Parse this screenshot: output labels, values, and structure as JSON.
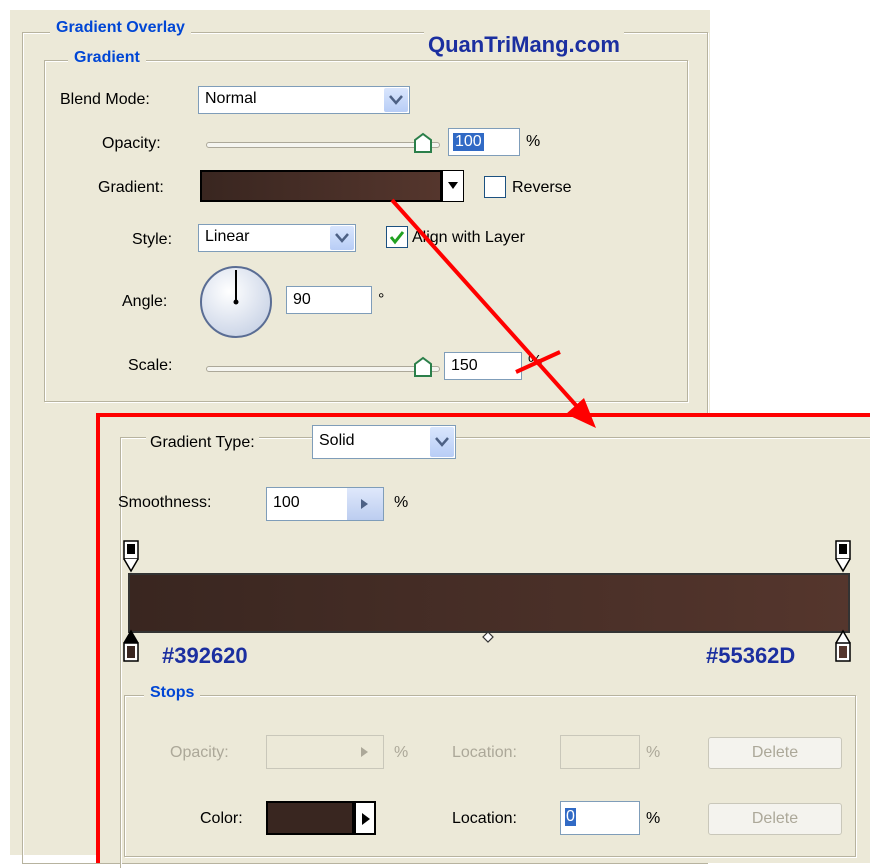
{
  "watermark": "QuanTriMang.com",
  "layer_style": {
    "section_title": "Gradient Overlay",
    "group_title": "Gradient",
    "blend_mode": {
      "label": "Blend Mode:",
      "value": "Normal"
    },
    "opacity": {
      "label": "Opacity:",
      "value": "100",
      "unit": "%",
      "level": 100
    },
    "gradient": {
      "label": "Gradient:",
      "reverse_label": "Reverse",
      "reverse_checked": false
    },
    "style": {
      "label": "Style:",
      "value": "Linear",
      "align_label": "Align with Layer",
      "align_checked": true
    },
    "angle": {
      "label": "Angle:",
      "value": "90",
      "unit": "°"
    },
    "scale": {
      "label": "Scale:",
      "value": "150",
      "unit": "%",
      "level": 100
    }
  },
  "gradient_editor": {
    "type": {
      "label": "Gradient Type:",
      "value": "Solid"
    },
    "smoothness": {
      "label": "Smoothness:",
      "value": "100",
      "unit": "%"
    },
    "stops_colors": {
      "left": "#392620",
      "right": "#55362D"
    },
    "stops": {
      "title": "Stops",
      "opacity_label": "Opacity:",
      "opacity_unit": "%",
      "location_label_1": "Location:",
      "location_unit_1": "%",
      "delete_1": "Delete",
      "color_label": "Color:",
      "location_label_2": "Location:",
      "location_value_2": "0",
      "location_unit_2": "%",
      "delete_2": "Delete"
    }
  },
  "colors": {
    "gradient_start": "#392620",
    "gradient_end": "#55362D",
    "accent_red": "#ff0000",
    "heading_blue": "#0046d5"
  }
}
